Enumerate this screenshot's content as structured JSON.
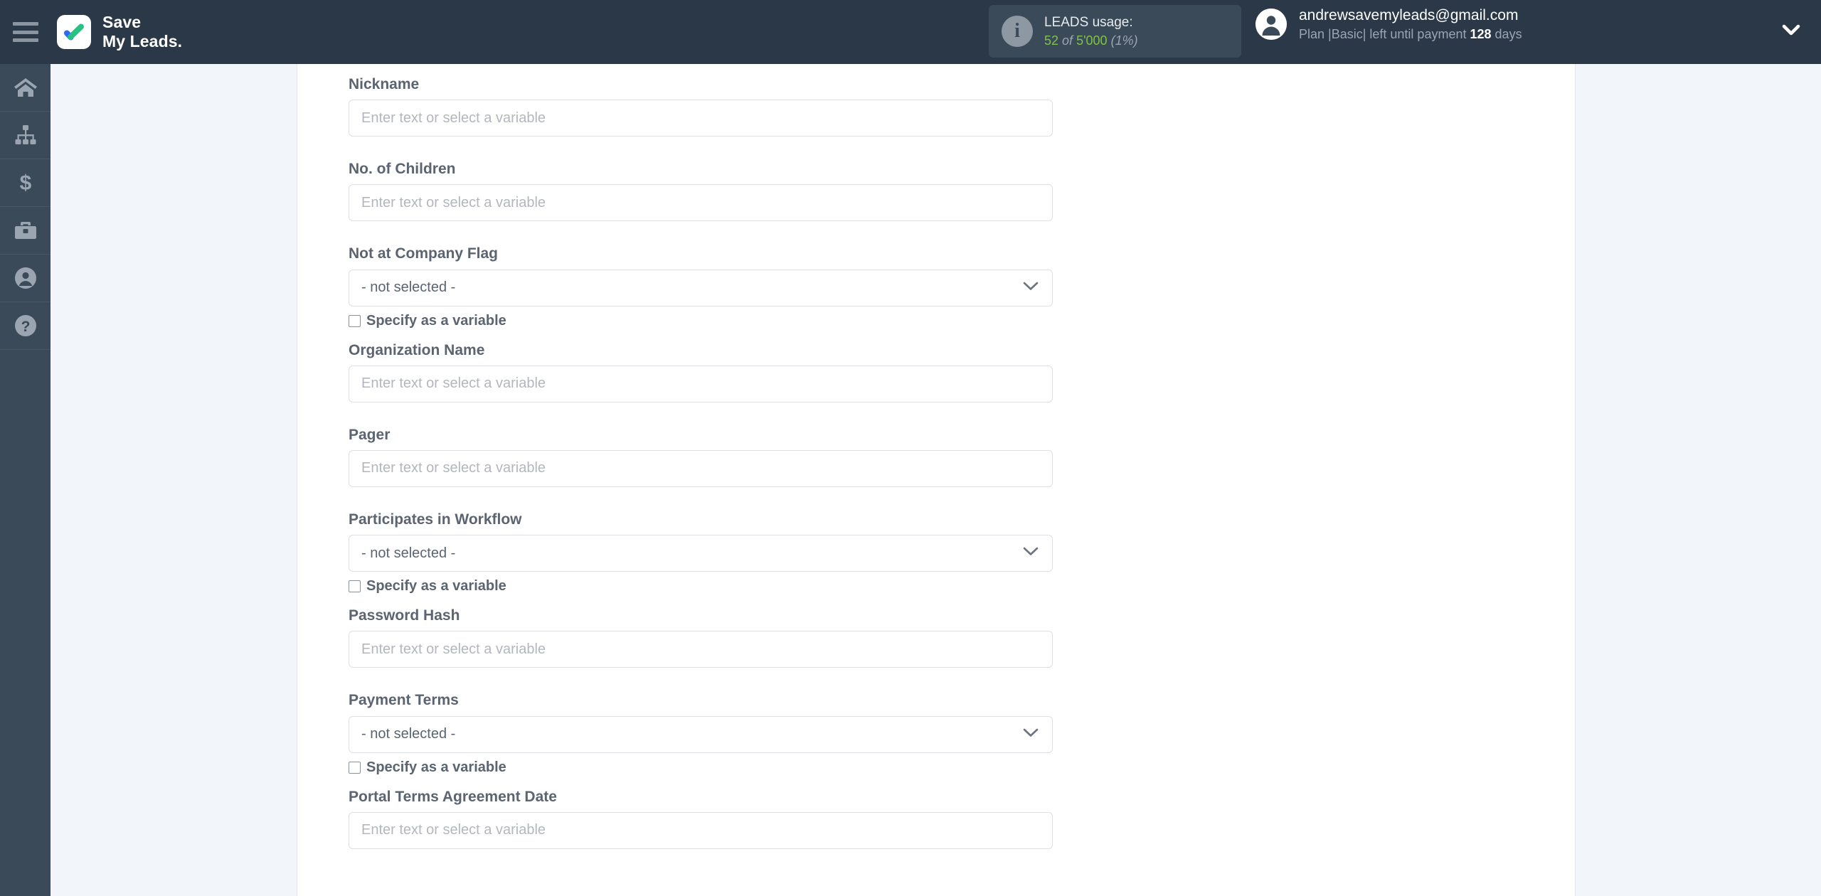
{
  "header": {
    "menu_icon": "hamburger-icon",
    "logo_icon": "savemyleads-check-logo",
    "brand_line1": "Save",
    "brand_line2": "My Leads.",
    "usage": {
      "info_icon": "info-icon",
      "title": "LEADS usage:",
      "used": "52",
      "of_word": "of",
      "total": "5'000",
      "percent": "(1%)",
      "accent_color": "#7fc24a"
    },
    "account": {
      "avatar_icon": "user-avatar-icon",
      "email": "andrewsavemyleads@gmail.com",
      "plan_prefix": "Plan |Basic| left until payment",
      "days_value": "128",
      "days_suffix": "days",
      "caret_icon": "chevron-down-icon"
    }
  },
  "sidebar": {
    "items": [
      {
        "name": "home",
        "icon": "home-icon"
      },
      {
        "name": "connections",
        "icon": "sitemap-icon"
      },
      {
        "name": "billing",
        "icon": "dollar-icon"
      },
      {
        "name": "business",
        "icon": "briefcase-icon"
      },
      {
        "name": "account",
        "icon": "user-circle-icon"
      },
      {
        "name": "help",
        "icon": "question-circle-icon"
      }
    ]
  },
  "form": {
    "placeholder_text": "Enter text or select a variable",
    "not_selected_text": "- not selected -",
    "variable_checkbox_label": "Specify as a variable",
    "fields": [
      {
        "label": "Nickname",
        "type": "text",
        "value": "",
        "has_variable_checkbox": false
      },
      {
        "label": "No. of Children",
        "type": "text",
        "value": "",
        "has_variable_checkbox": false
      },
      {
        "label": "Not at Company Flag",
        "type": "select",
        "value": "- not selected -",
        "has_variable_checkbox": true
      },
      {
        "label": "Organization Name",
        "type": "text",
        "value": "",
        "has_variable_checkbox": false
      },
      {
        "label": "Pager",
        "type": "text",
        "value": "",
        "has_variable_checkbox": false
      },
      {
        "label": "Participates in Workflow",
        "type": "select",
        "value": "- not selected -",
        "has_variable_checkbox": true
      },
      {
        "label": "Password Hash",
        "type": "text",
        "value": "",
        "has_variable_checkbox": false
      },
      {
        "label": "Payment Terms",
        "type": "select",
        "value": "- not selected -",
        "has_variable_checkbox": true
      },
      {
        "label": "Portal Terms Agreement Date",
        "type": "text",
        "value": "",
        "has_variable_checkbox": false
      }
    ]
  }
}
